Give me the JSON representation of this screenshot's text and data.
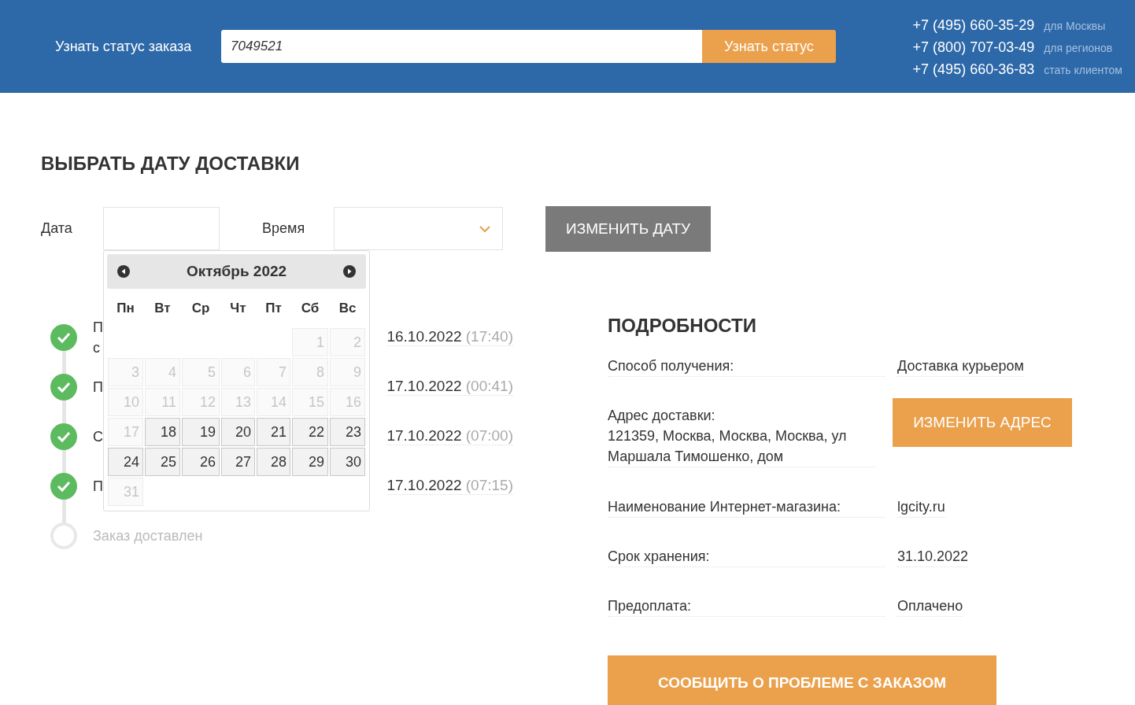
{
  "header": {
    "label": "Узнать статус заказа",
    "order_field": {
      "value": "7049521"
    },
    "button": "Узнать статус",
    "phones": [
      {
        "number": "+7 (495) 660-35-29",
        "note": "для Москвы"
      },
      {
        "number": "+7 (800) 707-03-49",
        "note": "для регионов"
      },
      {
        "number": "+7 (495) 660-36-83",
        "note": "стать клиентом"
      }
    ]
  },
  "delivery": {
    "title": "ВЫБРАТЬ ДАТУ ДОСТАВКИ",
    "date_label": "Дата",
    "time_label": "Время",
    "change_button": "ИЗМЕНИТЬ ДАТУ"
  },
  "calendar": {
    "month": "Октябрь 2022",
    "weekdays": [
      "Пн",
      "Вт",
      "Ср",
      "Чт",
      "Пт",
      "Сб",
      "Вс"
    ],
    "weeks": [
      [
        {
          "kind": "empty"
        },
        {
          "kind": "empty"
        },
        {
          "kind": "empty"
        },
        {
          "kind": "empty"
        },
        {
          "kind": "empty"
        },
        {
          "kind": "day",
          "day": "1",
          "disabled": true
        },
        {
          "kind": "day",
          "day": "2",
          "disabled": true
        }
      ],
      [
        {
          "day": "3",
          "disabled": true
        },
        {
          "day": "4",
          "disabled": true
        },
        {
          "day": "5",
          "disabled": true
        },
        {
          "day": "6",
          "disabled": true
        },
        {
          "day": "7",
          "disabled": true
        },
        {
          "day": "8",
          "disabled": true
        },
        {
          "day": "9",
          "disabled": true
        }
      ],
      [
        {
          "day": "10",
          "disabled": true
        },
        {
          "day": "11",
          "disabled": true
        },
        {
          "day": "12",
          "disabled": true
        },
        {
          "day": "13",
          "disabled": true
        },
        {
          "day": "14",
          "disabled": true
        },
        {
          "day": "15",
          "disabled": true
        },
        {
          "day": "16",
          "disabled": true
        }
      ],
      [
        {
          "day": "17",
          "disabled": true
        },
        {
          "day": "18",
          "disabled": false
        },
        {
          "day": "19",
          "disabled": false
        },
        {
          "day": "20",
          "disabled": false
        },
        {
          "day": "21",
          "disabled": false
        },
        {
          "day": "22",
          "disabled": false
        },
        {
          "day": "23",
          "disabled": false
        }
      ],
      [
        {
          "day": "24",
          "disabled": false
        },
        {
          "day": "25",
          "disabled": false
        },
        {
          "day": "26",
          "disabled": false
        },
        {
          "day": "27",
          "disabled": false
        },
        {
          "day": "28",
          "disabled": false
        },
        {
          "day": "29",
          "disabled": false
        },
        {
          "day": "30",
          "disabled": false
        }
      ],
      [
        {
          "kind": "day",
          "day": "31",
          "disabled": true
        },
        {
          "kind": "empty"
        },
        {
          "kind": "empty"
        },
        {
          "kind": "empty"
        },
        {
          "kind": "empty"
        },
        {
          "kind": "empty"
        },
        {
          "kind": "empty"
        }
      ]
    ]
  },
  "timeline": [
    {
      "text_lines": [
        "П",
        "с"
      ],
      "done": true,
      "date": "16.10.2022",
      "time": "(17:40)"
    },
    {
      "text_lines": [
        "П"
      ],
      "done": true,
      "date": "17.10.2022",
      "time": "(00:41)"
    },
    {
      "text_lines": [
        "С"
      ],
      "done": true,
      "date": "17.10.2022",
      "time": "(07:00)"
    },
    {
      "text_lines": [
        "П"
      ],
      "done": true,
      "date": "17.10.2022",
      "time": "(07:15)"
    },
    {
      "text_lines": [
        "Заказ доставлен"
      ],
      "done": false
    }
  ],
  "details": {
    "title": "ПОДРОБНОСТИ",
    "rows": [
      {
        "kind": "text",
        "label": "Способ получения:",
        "value": "Доставка курьером"
      },
      {
        "kind": "address",
        "label": "Адрес доставки:",
        "value": "121359, Москва, Москва, Москва, ул Маршала Тимошенко, дом",
        "button": "ИЗМЕНИТЬ АДРЕС"
      },
      {
        "kind": "text",
        "label": "Наименование Интернет-магазина:",
        "value": "lgcity.ru"
      },
      {
        "kind": "text",
        "label": "Срок хранения:",
        "value": "31.10.2022"
      },
      {
        "kind": "text",
        "label": "Предоплата:",
        "value": "Оплачено"
      }
    ],
    "report_button": "СООБЩИТЬ О ПРОБЛЕМЕ С ЗАКАЗОМ"
  }
}
